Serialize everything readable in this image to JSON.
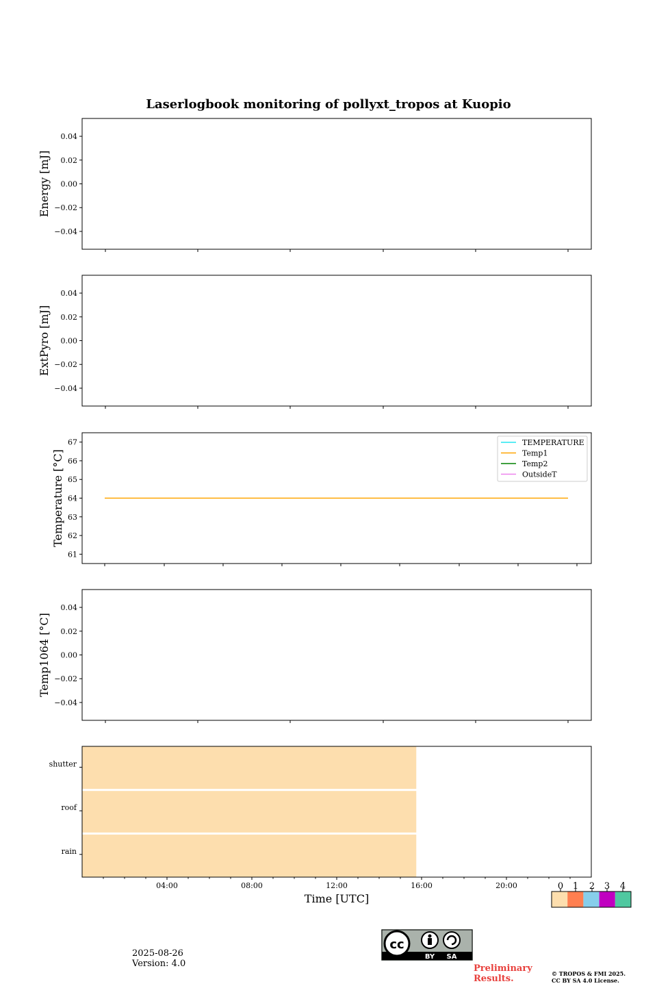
{
  "chart_data": [
    {
      "type": "line",
      "title": "Laserlogbook monitoring of pollyxt_tropos at Kuopio",
      "ylabel": "Energy [mJ]",
      "ylim": [
        -0.055,
        0.055
      ],
      "yticks": [
        0.04,
        0.02,
        0.0,
        -0.02,
        -0.04
      ],
      "ytick_labels": [
        "0.04",
        "0.02",
        "0.00",
        "−0.02",
        "−0.04"
      ],
      "series": []
    },
    {
      "type": "line",
      "ylabel": "ExtPyro [mJ]",
      "ylim": [
        -0.055,
        0.055
      ],
      "yticks": [
        0.04,
        0.02,
        0.0,
        -0.02,
        -0.04
      ],
      "ytick_labels": [
        "0.04",
        "0.02",
        "0.00",
        "−0.02",
        "−0.04"
      ],
      "series": []
    },
    {
      "type": "line",
      "ylabel": "Temperature [°C]",
      "ylim": [
        60.5,
        67.5
      ],
      "yticks": [
        67,
        66,
        65,
        64,
        63,
        62,
        61
      ],
      "ytick_labels": [
        "67",
        "66",
        "65",
        "64",
        "63",
        "62",
        "61"
      ],
      "legend_position": "top-right",
      "series": [
        {
          "name": "TEMPERATURE",
          "color": "#22e5f0",
          "x": [],
          "y": []
        },
        {
          "name": "Temp1",
          "color": "#ffa500",
          "x": [
            1.0,
            23.9
          ],
          "y": [
            64,
            64
          ]
        },
        {
          "name": "Temp2",
          "color": "#008000",
          "x": [],
          "y": []
        },
        {
          "name": "OutsideT",
          "color": "#ee82ee",
          "x": [],
          "y": []
        }
      ]
    },
    {
      "type": "line",
      "ylabel": "Temp1064 [°C]",
      "ylim": [
        -0.055,
        0.055
      ],
      "yticks": [
        0.04,
        0.02,
        0.0,
        -0.02,
        -0.04
      ],
      "ytick_labels": [
        "0.04",
        "0.02",
        "0.00",
        "−0.02",
        "−0.04"
      ],
      "series": []
    },
    {
      "type": "heatmap",
      "rows": [
        "shutter",
        "roof",
        "rain"
      ],
      "x_hours_range": [
        0,
        24
      ],
      "xticks": [
        4,
        8,
        12,
        16,
        20
      ],
      "xtick_labels": [
        "04:00",
        "08:00",
        "12:00",
        "16:00",
        "20:00"
      ],
      "xlabel": "Time [UTC]",
      "cells": [
        {
          "row": "shutter",
          "start": 0,
          "end": 15.75,
          "flag": 0
        },
        {
          "row": "roof",
          "start": 0,
          "end": 15.75,
          "flag": 0
        },
        {
          "row": "rain",
          "start": 0,
          "end": 15.75,
          "flag": 0
        }
      ],
      "colorbar": {
        "labels": [
          "0",
          "1",
          "2",
          "3",
          "4"
        ],
        "colors": [
          "#fddeae",
          "#ff7f50",
          "#87ceeb",
          "#c000c0",
          "#50c8a0"
        ]
      }
    }
  ],
  "footer": {
    "date": "2025-08-26",
    "version": "Version: 4.0",
    "preliminary_line1": "Preliminary",
    "preliminary_line2": "Results.",
    "copyright_line1": "© TROPOS & FMI 2025.",
    "copyright_line2": "CC BY SA 4.0 License.",
    "license_badge": {
      "text": "cc",
      "by": "BY",
      "sa": "SA"
    }
  }
}
